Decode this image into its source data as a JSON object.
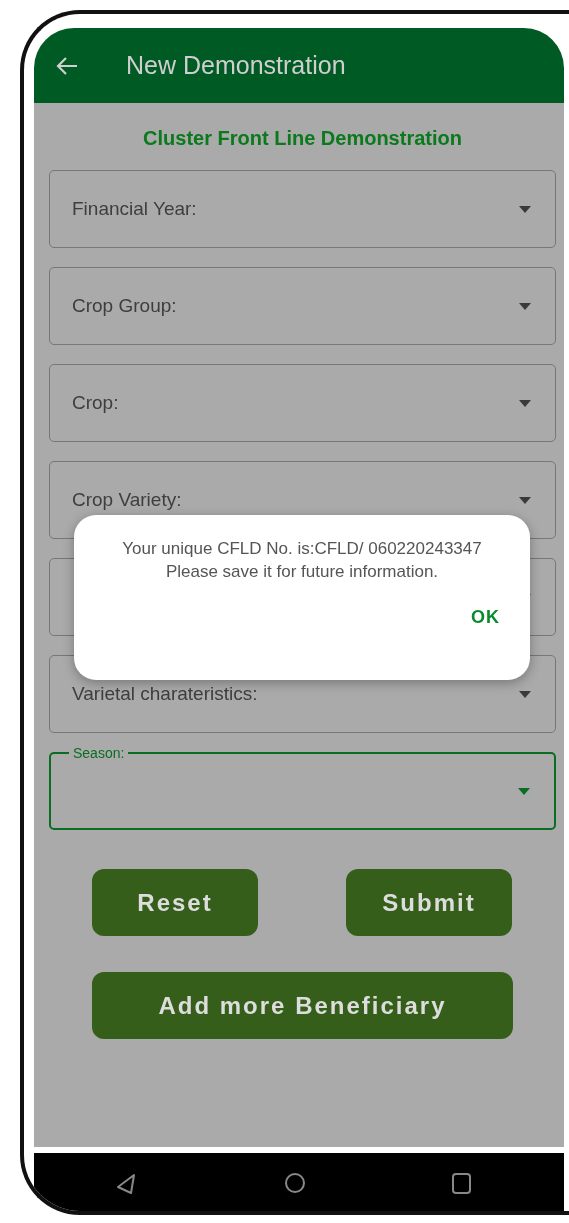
{
  "app_bar": {
    "title": "New Demonstration"
  },
  "heading": "Cluster Front Line Demonstration",
  "fields": [
    {
      "label": "Financial Year:",
      "kind": "dropdown",
      "focused": false
    },
    {
      "label": "Crop Group:",
      "kind": "dropdown",
      "focused": false
    },
    {
      "label": "Crop:",
      "kind": "dropdown",
      "focused": false
    },
    {
      "label": "Crop Variety:",
      "kind": "dropdown",
      "focused": false
    },
    {
      "kind": "dropdown",
      "focused": false
    },
    {
      "label": "Varietal charateristics:",
      "kind": "dropdown",
      "focused": false
    },
    {
      "label": "Season:",
      "kind": "dropdown",
      "focused": true
    }
  ],
  "buttons": [
    {
      "label": "Reset"
    },
    {
      "label": "Submit"
    }
  ],
  "wide_button": {
    "label": "Add more Beneficiary"
  },
  "dialog": {
    "message": "Your unique CFLD No. is:CFLD/ 060220243347 Please save it for future information.",
    "button": "OK"
  }
}
